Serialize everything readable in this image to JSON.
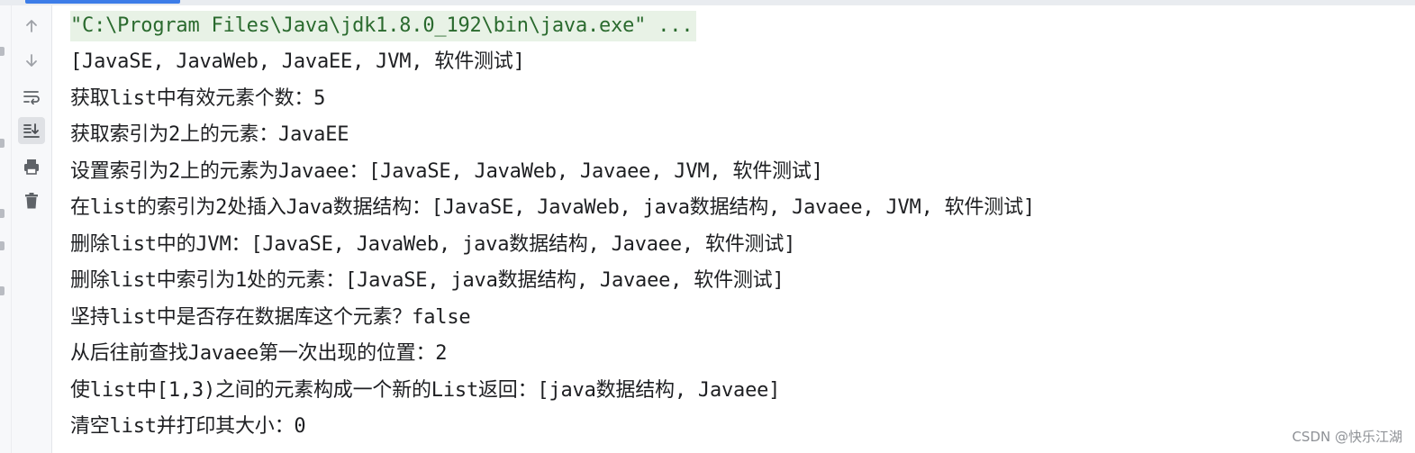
{
  "toolbar": {
    "buttons": [
      {
        "icon": "arrow-up-icon"
      },
      {
        "icon": "arrow-down-icon"
      },
      {
        "icon": "soft-wrap-icon"
      },
      {
        "icon": "scroll-to-end-icon",
        "active": true
      },
      {
        "icon": "print-icon"
      },
      {
        "icon": "trash-icon"
      }
    ]
  },
  "console": {
    "lines": [
      "\"C:\\Program Files\\Java\\jdk1.8.0_192\\bin\\java.exe\" ...",
      "[JavaSE, JavaWeb, JavaEE, JVM, 软件测试]",
      "获取list中有效元素个数：5",
      "获取索引为2上的元素：JavaEE",
      "设置索引为2上的元素为Javaee：[JavaSE, JavaWeb, Javaee, JVM, 软件测试]",
      "在list的索引为2处插入Java数据结构：[JavaSE, JavaWeb, java数据结构, Javaee, JVM, 软件测试]",
      "删除list中的JVM：[JavaSE, JavaWeb, java数据结构, Javaee, 软件测试]",
      "删除list中索引为1处的元素：[JavaSE, java数据结构, Javaee, 软件测试]",
      "坚持list中是否存在数据库这个元素？false",
      "从后往前查找Javaee第一次出现的位置：2",
      "使list中[1,3)之间的元素构成一个新的List返回：[java数据结构, Javaee]",
      "清空list并打印其大小：0"
    ]
  },
  "watermark": "CSDN @快乐江湖",
  "colors": {
    "command_text": "#2a6a2e",
    "command_highlight": "#e8f2e6",
    "output_text": "#1e1f22",
    "toolbar_bg": "#f7f8fa",
    "accent": "#3d7de8"
  }
}
